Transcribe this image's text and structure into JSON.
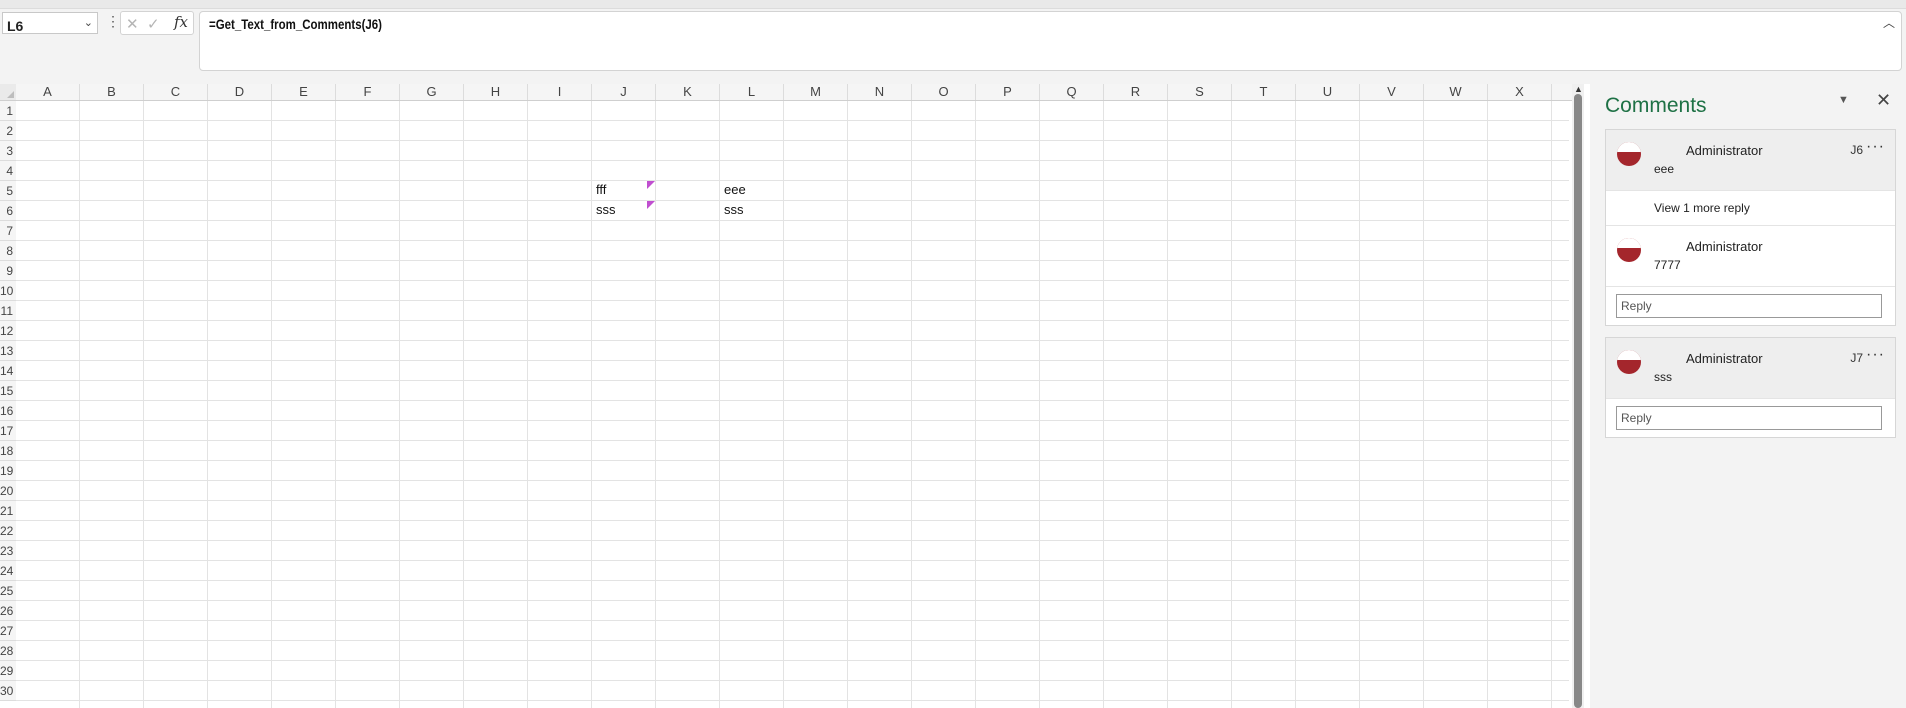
{
  "formula_bar": {
    "name_box": "L6",
    "fx_label": "fx",
    "formula": "=Get_Text_from_Comments(J6)"
  },
  "sheet": {
    "columns": [
      "A",
      "B",
      "C",
      "D",
      "E",
      "F",
      "G",
      "H",
      "I",
      "J",
      "K",
      "L",
      "M",
      "N",
      "O",
      "P",
      "Q",
      "R",
      "S",
      "T",
      "U",
      "V",
      "W",
      "X"
    ],
    "rows": [
      "1",
      "2",
      "3",
      "4",
      "5",
      "6",
      "7",
      "8",
      "9",
      "10",
      "11",
      "12",
      "13",
      "14",
      "15",
      "16",
      "17",
      "18",
      "19",
      "20",
      "21",
      "22",
      "23",
      "24",
      "25",
      "26",
      "27",
      "28",
      "29",
      "30"
    ],
    "cells": {
      "J6": "fff",
      "J7": "sss",
      "L6": "eee",
      "L7": "sss"
    }
  },
  "comments_pane": {
    "title": "Comments",
    "threads": [
      {
        "cell": "J6",
        "author": "Administrator",
        "text": "eee",
        "view_more": "View 1 more reply",
        "reply": {
          "author": "Administrator",
          "text": "7777"
        },
        "reply_placeholder": "Reply"
      },
      {
        "cell": "J7",
        "author": "Administrator",
        "text": "sss",
        "reply_placeholder": "Reply"
      }
    ]
  }
}
